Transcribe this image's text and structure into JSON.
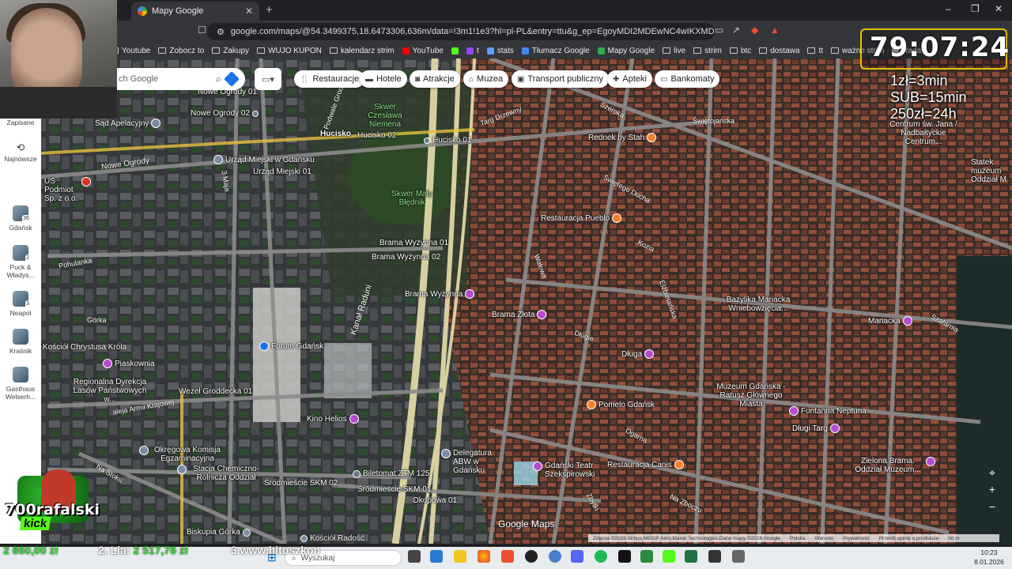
{
  "browser": {
    "tab_title": "Mapy Google",
    "tab_close": "✕",
    "new_tab": "+",
    "url": "google.com/maps/@54.3499375,18.6473306,636m/data=!3m1!1e3?hl=pl-PL&entry=ttu&g_ep=EgoyMDI2MDEwNC4wIKXMDSoKLDEwMDc5Mj...",
    "window_controls": [
      "–",
      "❐",
      "✕"
    ]
  },
  "bookmarks": [
    {
      "label": "Youtube",
      "icon": "folder-icon"
    },
    {
      "label": "Zobocz to",
      "icon": "folder-icon"
    },
    {
      "label": "Zakupy",
      "icon": "folder-icon"
    },
    {
      "label": "WUJO KUPON",
      "icon": "folder-icon"
    },
    {
      "label": "kalendarz strim",
      "icon": "folder-icon"
    },
    {
      "label": "YouTube",
      "icon": "youtube-icon",
      "color": "#ff0000"
    },
    {
      "label": "",
      "icon": "kick-icon",
      "color": "#53fc18"
    },
    {
      "label": "t",
      "icon": "twitch-icon",
      "color": "#9146ff"
    },
    {
      "label": "stats",
      "icon": "stats-icon",
      "color": "#5aa0ff"
    },
    {
      "label": "Tłumacz Google",
      "icon": "translate-icon",
      "color": "#4285f4"
    },
    {
      "label": "Mapy Google",
      "icon": "maps-icon",
      "color": "#34a853"
    },
    {
      "label": "live",
      "icon": "folder-icon"
    },
    {
      "label": "strim",
      "icon": "folder-icon"
    },
    {
      "label": "btc",
      "icon": "folder-icon"
    },
    {
      "label": "dostawa",
      "icon": "folder-icon"
    },
    {
      "label": "tt",
      "icon": "folder-icon"
    },
    {
      "label": "ważne strim",
      "icon": "folder-icon"
    },
    {
      "label": "Rada",
      "icon": "bookmark-icon"
    }
  ],
  "maps": {
    "search_placeholder": "ch Google",
    "chips": [
      {
        "label": "Restauracje",
        "icon": "fork-knife-icon"
      },
      {
        "label": "Hotele",
        "icon": "bed-icon"
      },
      {
        "label": "Atrakcje",
        "icon": "camera-icon"
      },
      {
        "label": "Muzea",
        "icon": "museum-icon"
      },
      {
        "label": "Transport publiczny",
        "icon": "transit-icon"
      },
      {
        "label": "Apteki",
        "icon": "pharmacy-icon"
      },
      {
        "label": "Bankomaty",
        "icon": "atm-icon"
      }
    ],
    "sidebar": [
      {
        "label": "Zapisane",
        "icon": "bookmark-icon"
      },
      {
        "label": "Najnowsze",
        "icon": "history-icon"
      },
      {
        "label": "Gdańsk",
        "badge": "36"
      },
      {
        "label": "Puck & Władys...",
        "badge": "2"
      },
      {
        "label": "Neapol",
        "badge": "3"
      },
      {
        "label": "Kraśnik",
        "badge": ""
      },
      {
        "label": "Gasthaus Welserh...",
        "badge": ""
      }
    ],
    "places": [
      {
        "name": "Skwer Czesława Niemena",
        "type": "park"
      },
      {
        "name": "Sąd Apelacyjny",
        "type": "gov"
      },
      {
        "name": "Nowe Ogrody 01",
        "type": "stop"
      },
      {
        "name": "Nowe Ogrody 02",
        "type": "stop"
      },
      {
        "name": "Hucisko",
        "type": "street"
      },
      {
        "name": "Hucisko 02",
        "type": "stop"
      },
      {
        "name": "Hucisko 01",
        "type": "stop"
      },
      {
        "name": "Urząd Miejski w Gdańsku",
        "type": "gov"
      },
      {
        "name": "Urząd Miejski 01",
        "type": "stop"
      },
      {
        "name": "Skwer Mały Błędnik",
        "type": "park"
      },
      {
        "name": "Rednek by Stah",
        "type": "food"
      },
      {
        "name": "Restauracja Pueblo",
        "type": "food"
      },
      {
        "name": "Brama Wyżynna 01",
        "type": "stop"
      },
      {
        "name": "Brama Wyżynna 02",
        "type": "stop"
      },
      {
        "name": "Brama Wyżynna",
        "type": "sight"
      },
      {
        "name": "Brama Złota",
        "type": "sight"
      },
      {
        "name": "Bazylika Mariacka Wniebowzięcia...",
        "type": "church"
      },
      {
        "name": "Mariacka",
        "type": "sight"
      },
      {
        "name": "Długa",
        "type": "sight"
      },
      {
        "name": "Forum Gdańsk",
        "type": "shop"
      },
      {
        "name": "Kościół Chrystusa Króla",
        "type": "church"
      },
      {
        "name": "Piaskownia",
        "type": "sight"
      },
      {
        "name": "Regionalna Dyrekcja Lasów Państwowych w...",
        "type": "gov"
      },
      {
        "name": "Wezeł Groddecka 01",
        "type": "stop"
      },
      {
        "name": "Kino Helios",
        "type": "sight"
      },
      {
        "name": "Muzeum Gdańska - Ratusz Głównego Miasta",
        "type": "museum"
      },
      {
        "name": "Fontanna Neptuna",
        "type": "sight"
      },
      {
        "name": "Długi Targ",
        "type": "sight"
      },
      {
        "name": "Pomelo Gdańsk",
        "type": "food"
      },
      {
        "name": "Delegatura ABW w Gdańsku",
        "type": "gov"
      },
      {
        "name": "Gdański Teatr Szekspirowski",
        "type": "sight"
      },
      {
        "name": "Restauracja Canis",
        "type": "food"
      },
      {
        "name": "Zielona Brama. Oddział Muzeum...",
        "type": "museum"
      },
      {
        "name": "Okręgowa Komisja Egzaminacyjna",
        "type": "gov"
      },
      {
        "name": "Stacja Chemiczno-Rolnicza Oddział",
        "type": "gov"
      },
      {
        "name": "Biletomat ZTM 125",
        "type": "stop"
      },
      {
        "name": "Śródmieście SKM 02",
        "type": "stop"
      },
      {
        "name": "Śródmieście SKM 01",
        "type": "stop"
      },
      {
        "name": "Okopowa 01",
        "type": "stop"
      },
      {
        "name": "Kościół Radość",
        "type": "church"
      },
      {
        "name": "Biskupia Górka",
        "type": "sight"
      },
      {
        "name": "Centrum św. Jana / Nadbałtyckie Centrum...",
        "type": "sight"
      },
      {
        "name": "Statek muzeum Oddział M",
        "type": "museum"
      },
      {
        "name": "US Podmiot Sp. z o.o.",
        "type": "hospital"
      }
    ],
    "streets": [
      "Targ Drzewny",
      "Nowe Ogrody",
      "Szeroka",
      "Świętojańska",
      "Świętego Ducha",
      "Kozia",
      "Ogarna",
      "Długie",
      "Pohulanka",
      "Górka",
      "Kanał Raduni",
      "aleja Armii Krajowej",
      "Na Stoku",
      "3 Maja",
      "Podwale Grodzkie",
      "Wałowa",
      "Elżbietańska",
      "Zbytki",
      "Na Zboczu",
      "Szafarnia"
    ],
    "google_maps_label": "Google Maps",
    "footer": [
      "Zdjęcia ©2026 Airbus,MGGP Aero,Maxar Technologies,Dane mapy ©2026 Google",
      "Polska",
      "Warunki",
      "Prywatność",
      "Prześlij opinię o produkcie",
      "50 m"
    ],
    "zoom": [
      "+",
      "−"
    ]
  },
  "overlay": {
    "timer": "79:07:24",
    "rates": [
      "1zł=3min",
      "SUB=15min",
      "250zł=24h"
    ],
    "streamer_name": "700rafalski",
    "platform": "kick",
    "ticker": {
      "first_amount": "2 860,00 zł",
      "second_prefix": "2. Lia:",
      "second_amount": "2 517,76 zł",
      "third": "3.www.hitoszkon"
    }
  },
  "taskbar": {
    "search_placeholder": "Wyszukaj",
    "time": "10:23",
    "date": "8.01.2026"
  }
}
